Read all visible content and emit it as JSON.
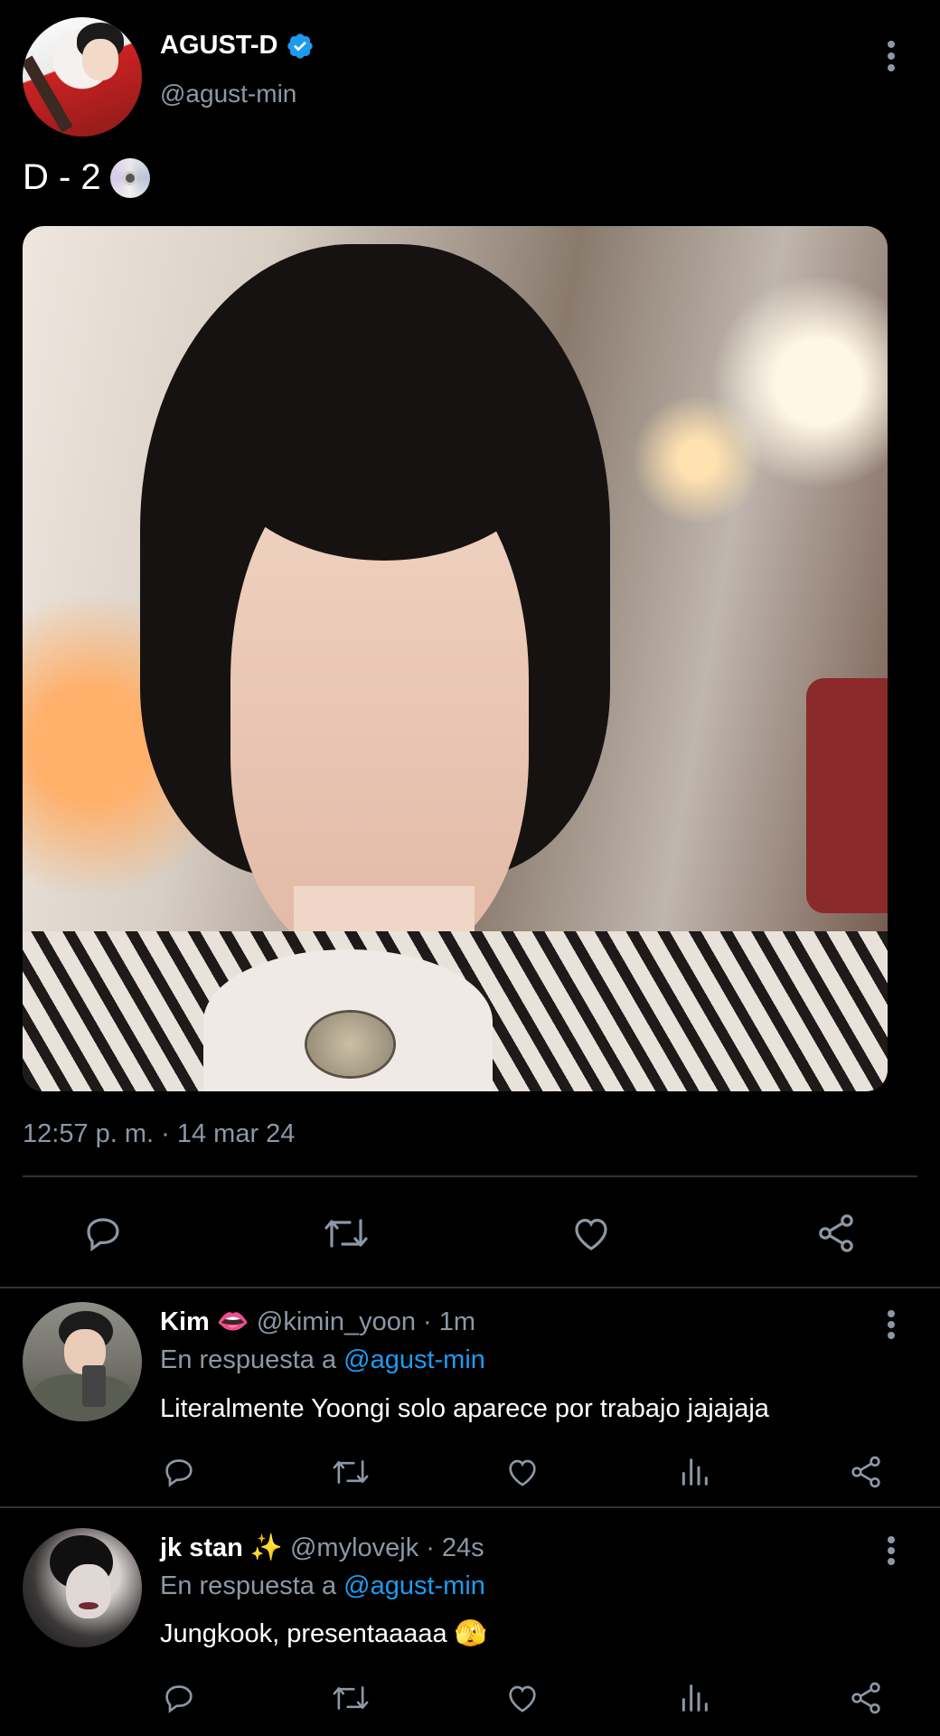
{
  "main_tweet": {
    "display_name": "AGUST-D",
    "verified_badge": "verified-badge-icon",
    "handle": "@agust-min",
    "text": "D - 2",
    "text_emoji": "cd-disc-icon",
    "timestamp": "12:57 p. m. · 14 mar 24",
    "actions": [
      "reply-icon",
      "retweet-icon",
      "like-icon",
      "share-icon"
    ]
  },
  "replies": [
    {
      "display_name": "Kim",
      "name_emoji": "👄",
      "handle": "@kimin_yoon",
      "separator": "·",
      "time": "1m",
      "replying_prefix": "En respuesta a",
      "replying_to": "@agust-min",
      "text": "Literalmente Yoongi solo aparece por trabajo jajajaja",
      "text_emoji": ""
    },
    {
      "display_name": "jk stan",
      "name_emoji": "✨",
      "handle": "@mylovejk",
      "separator": "·",
      "time": "24s",
      "replying_prefix": "En respuesta a",
      "replying_to": "@agust-min",
      "text": "Jungkook, presentaaaaa",
      "text_emoji": "🫣"
    }
  ],
  "colors": {
    "background": "#000000",
    "text": "#e7e9ea",
    "secondary": "#8b98a5",
    "accent": "#1d9bf0",
    "divider": "#2f3336"
  }
}
